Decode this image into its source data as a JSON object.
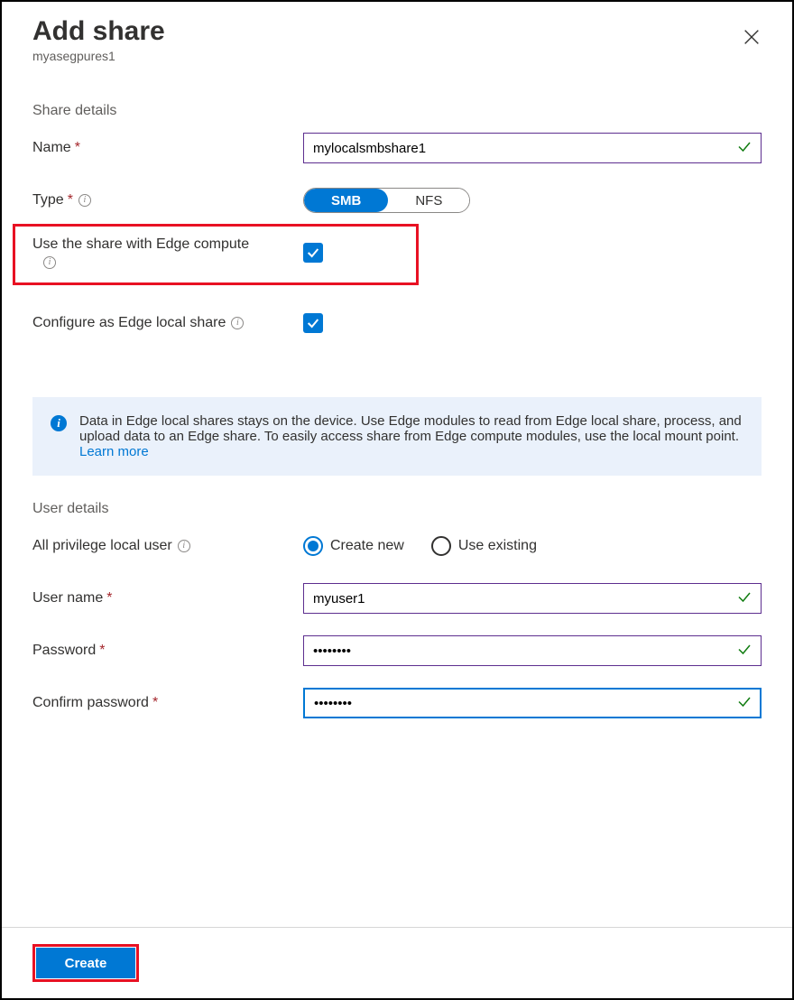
{
  "header": {
    "title": "Add share",
    "subtitle": "myasegpures1"
  },
  "sections": {
    "share_details": "Share details",
    "user_details": "User details"
  },
  "fields": {
    "name": {
      "label": "Name",
      "value": "mylocalsmbshare1"
    },
    "type": {
      "label": "Type",
      "options": {
        "smb": "SMB",
        "nfs": "NFS"
      },
      "selected": "smb"
    },
    "use_edge_compute": {
      "label": "Use the share with Edge compute",
      "checked": true
    },
    "configure_local": {
      "label": "Configure as Edge local share",
      "checked": true
    },
    "all_priv_user": {
      "label": "All privilege local user",
      "options": {
        "create_new": "Create new",
        "use_existing": "Use existing"
      },
      "selected": "create_new"
    },
    "username": {
      "label": "User name",
      "value": "myuser1"
    },
    "password": {
      "label": "Password",
      "value": "••••••••"
    },
    "confirm_password": {
      "label": "Confirm password",
      "value": "••••••••"
    }
  },
  "callout": {
    "text": "Data in Edge local shares stays on the device. Use Edge modules to read from Edge local share, process, and upload data to an Edge share. To easily access share from Edge compute modules, use the local mount point. ",
    "link": "Learn more"
  },
  "footer": {
    "create": "Create"
  }
}
